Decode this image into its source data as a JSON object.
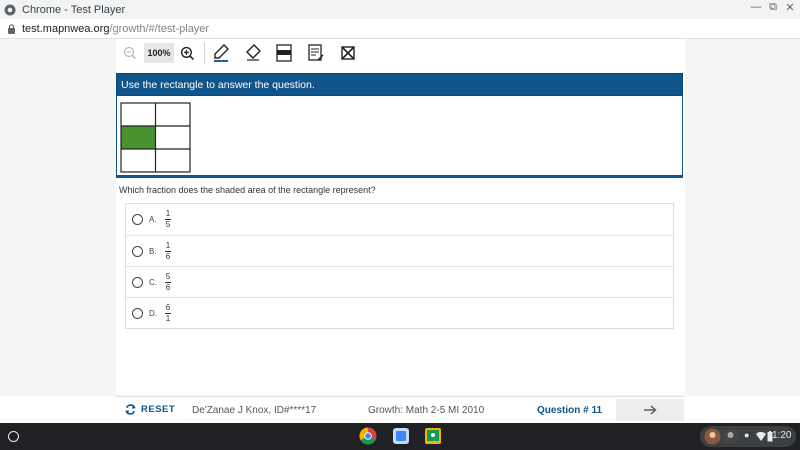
{
  "window": {
    "title": "Chrome - Test Player"
  },
  "address": {
    "host": "test.mapnwea.org",
    "path": "/growth/#/test-player"
  },
  "toolbar": {
    "zoom_value": "100%"
  },
  "passage": {
    "header": "Use the rectangle to answer the question."
  },
  "question": {
    "text": "Which fraction does the shaded area of the rectangle represent?"
  },
  "options": [
    {
      "letter": "A.",
      "numerator": "1",
      "denominator": "5"
    },
    {
      "letter": "B.",
      "numerator": "1",
      "denominator": "6"
    },
    {
      "letter": "C.",
      "numerator": "5",
      "denominator": "6"
    },
    {
      "letter": "D.",
      "numerator": "6",
      "denominator": "1"
    }
  ],
  "footer": {
    "reset_label": "RESET",
    "student": "De'Zanae J Knox, ID#****17",
    "test_name": "Growth: Math 2-5 MI 2010",
    "question_number": "Question # 11"
  },
  "shelf": {
    "time": "1:20"
  },
  "colors": {
    "header_blue": "#10558a",
    "shaded_green": "#4a9130"
  }
}
